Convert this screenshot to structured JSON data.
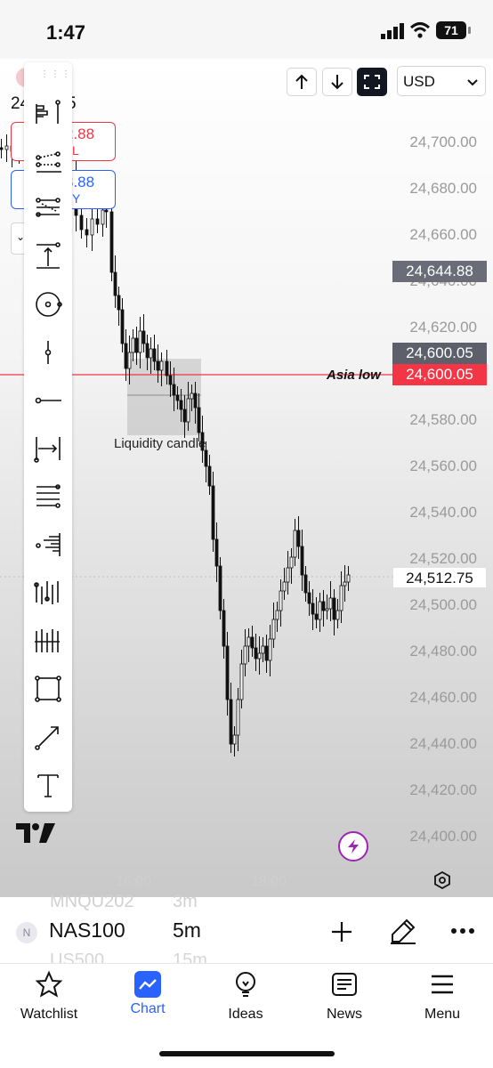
{
  "status_bar": {
    "time": "1:47",
    "battery": "71"
  },
  "top_controls": {
    "currency": "USD"
  },
  "price_axis": {
    "labels": [
      "24,700.00",
      "24,680.00",
      "24,660.00",
      "24,640.00",
      "24,620.00",
      "24,600.00",
      "24,580.00",
      "24,560.00",
      "24,540.00",
      "24,520.00",
      "24,500.00",
      "24,480.00",
      "24,460.00",
      "24,440.00",
      "24,420.00",
      "24,400.00"
    ],
    "marker_gray": "24,644.88",
    "marker_dark": "24,600.05",
    "marker_red": "24,600.05",
    "current": "24,512.75"
  },
  "annotations": {
    "asia_low": "Asia low",
    "liquidity": "Liquidity candle"
  },
  "header_price": {
    "prefix": "24",
    "suffix": "75"
  },
  "order_sell": {
    "price": "2.88",
    "label": "L"
  },
  "order_buy": {
    "price": "3.88",
    "label": "Y"
  },
  "time_axis": [
    "16:00",
    "18:00"
  ],
  "symbols": {
    "prev": "MNQU202",
    "current": "NAS100",
    "next": "US500",
    "badge": "N"
  },
  "intervals": {
    "prev": "3m",
    "current": "5m",
    "next": "15m"
  },
  "nav": [
    {
      "label": "Watchlist"
    },
    {
      "label": "Chart"
    },
    {
      "label": "Ideas"
    },
    {
      "label": "News"
    },
    {
      "label": "Menu"
    }
  ],
  "colors": {
    "accent_blue": "#2962ff",
    "red": "#f23645",
    "gray_marker": "#6a6d78",
    "dark_marker": "#5d606b"
  }
}
